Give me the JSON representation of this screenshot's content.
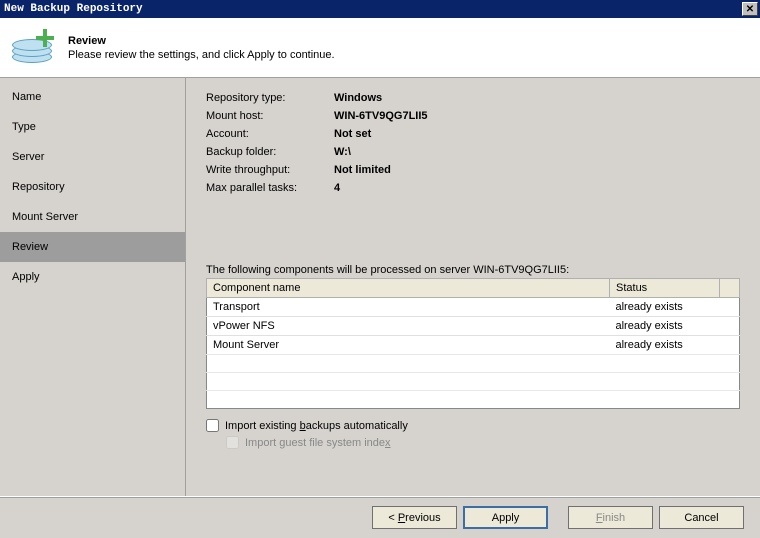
{
  "window": {
    "title": "New Backup Repository"
  },
  "header": {
    "title": "Review",
    "subtitle": "Please review the settings, and click Apply to continue."
  },
  "sidebar": {
    "steps": [
      {
        "label": "Name"
      },
      {
        "label": "Type"
      },
      {
        "label": "Server"
      },
      {
        "label": "Repository"
      },
      {
        "label": "Mount Server"
      },
      {
        "label": "Review",
        "active": true
      },
      {
        "label": "Apply"
      }
    ]
  },
  "review": {
    "fields": [
      {
        "key": "Repository type:",
        "value": "Windows"
      },
      {
        "key": "Mount host:",
        "value": "WIN-6TV9QG7LII5"
      },
      {
        "key": "Account:",
        "value": "Not set"
      },
      {
        "key": "Backup folder:",
        "value": "W:\\"
      },
      {
        "key": "Write throughput:",
        "value": "Not limited"
      },
      {
        "key": "Max parallel tasks:",
        "value": "4"
      }
    ],
    "components_note": "The following components will be processed on server WIN-6TV9QG7LII5:",
    "columns": {
      "component": "Component name",
      "status": "Status"
    },
    "rows": [
      {
        "component": "Transport",
        "status": "already exists"
      },
      {
        "component": "vPower NFS",
        "status": "already exists"
      },
      {
        "component": "Mount Server",
        "status": "already exists"
      }
    ],
    "checks": {
      "import_backups_pre": "Import existing ",
      "import_backups_u": "b",
      "import_backups_post": "ackups automatically",
      "import_guest_pre": "Import guest file system inde",
      "import_guest_u": "x"
    }
  },
  "footer": {
    "previous_pre": "< ",
    "previous_u": "P",
    "previous_post": "revious",
    "apply": "Apply",
    "finish": "Finish",
    "cancel": "Cancel"
  }
}
